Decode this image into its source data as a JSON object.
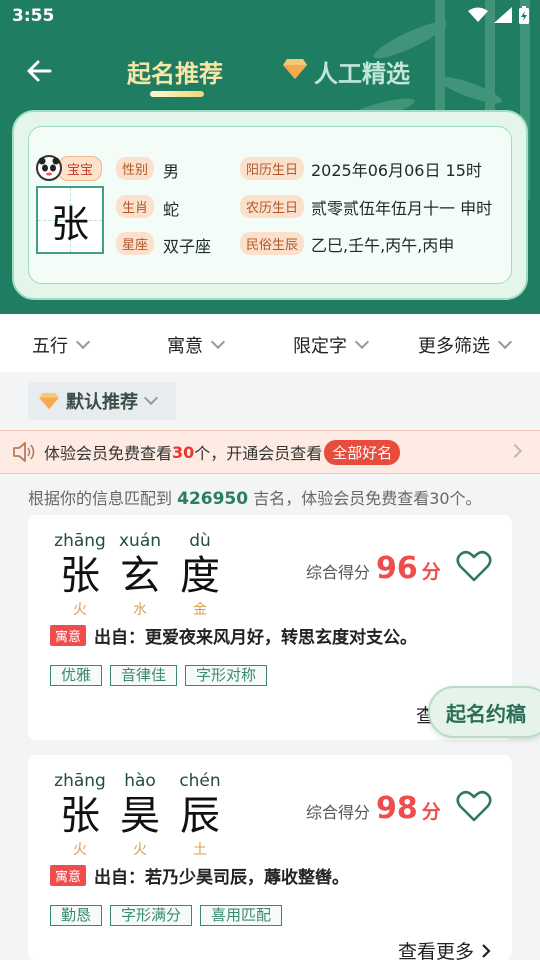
{
  "status": {
    "time": "3:55"
  },
  "tabs": {
    "active": "起名推荐",
    "inactive": "人工精选"
  },
  "profile": {
    "baby_label": "宝宝",
    "surname": "张",
    "gender_label": "性别",
    "gender": "男",
    "zodiac_label": "生肖",
    "zodiac": "蛇",
    "star_label": "星座",
    "star": "双子座",
    "solar_label": "阳历生日",
    "solar": "2025年06月06日 15时",
    "lunar_label": "农历生日",
    "lunar": "贰零贰伍年伍月十一 申时",
    "folk_label": "民俗生辰",
    "folk": "乙巳,壬午,丙午,丙申"
  },
  "filters": {
    "f1": "五行",
    "f2": "寓意",
    "f3": "限定字",
    "f4": "更多筛选"
  },
  "default_sort": "默认推荐",
  "banner": {
    "pre": "体验会员免费查看",
    "count": "30",
    "mid": "个，开通会员查看",
    "pill": "全部好名"
  },
  "match": {
    "pre": "根据你的信息匹配到",
    "count": "426950",
    "post": "吉名，体验会员免费查看30个。"
  },
  "names": [
    {
      "chars": [
        {
          "py": "zhāng",
          "ch": "张",
          "el": "火"
        },
        {
          "py": "xuán",
          "ch": "玄",
          "el": "水"
        },
        {
          "py": "dù",
          "ch": "度",
          "el": "金"
        }
      ],
      "score_label": "综合得分",
      "score": "96",
      "score_unit": "分",
      "meaning_tag": "寓意",
      "meaning": "出自：更爱夜来风月好，转思玄度对支公。",
      "chips": [
        "优雅",
        "音律佳",
        "字形对称"
      ],
      "more": "查看更多"
    },
    {
      "chars": [
        {
          "py": "zhāng",
          "ch": "张",
          "el": "火"
        },
        {
          "py": "hào",
          "ch": "昊",
          "el": "火"
        },
        {
          "py": "chén",
          "ch": "辰",
          "el": "土"
        }
      ],
      "score_label": "综合得分",
      "score": "98",
      "score_unit": "分",
      "meaning_tag": "寓意",
      "meaning": "出自：若乃少昊司辰，蓐收整辔。",
      "chips": [
        "勤恳",
        "字形满分",
        "喜用匹配"
      ],
      "more": "查看更多"
    }
  ],
  "float_button": "起名约稿",
  "colors": {
    "header": "#1f7d62",
    "accent_red": "#ef4c4c",
    "gold": "#d6a24b"
  }
}
